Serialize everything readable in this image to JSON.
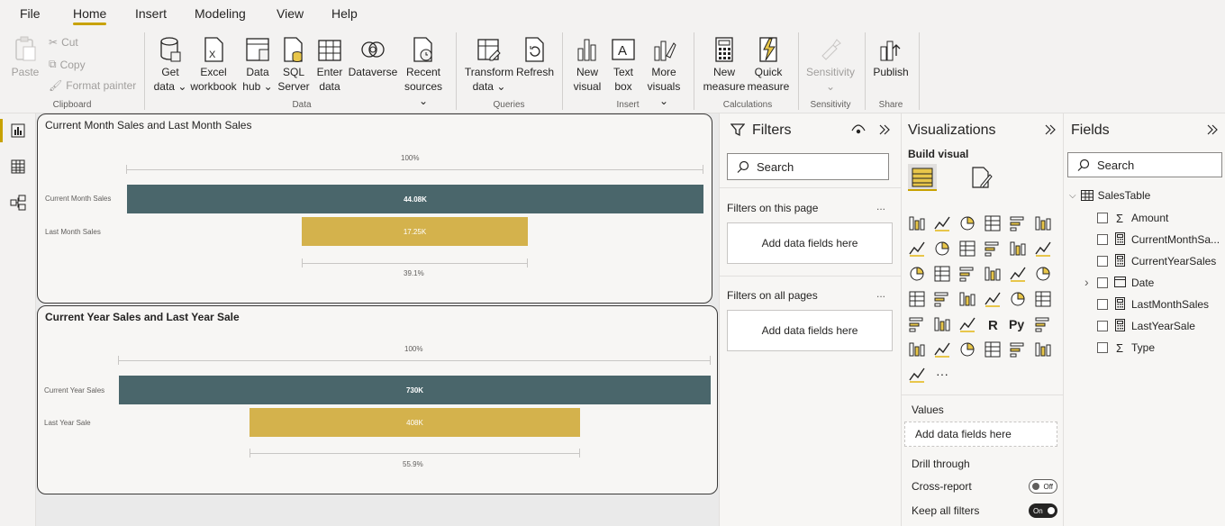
{
  "menu": {
    "items": [
      "File",
      "Home",
      "Insert",
      "Modeling",
      "View",
      "Help"
    ],
    "active": "Home"
  },
  "ribbon": {
    "clipboard": {
      "paste": "Paste",
      "cut": "Cut",
      "copy": "Copy",
      "format_painter": "Format painter",
      "group": "Clipboard"
    },
    "data": {
      "get_data": [
        "Get",
        "data ⌄"
      ],
      "excel": [
        "Excel",
        "workbook"
      ],
      "data_hub": [
        "Data",
        "hub ⌄"
      ],
      "sql": [
        "SQL",
        "Server"
      ],
      "enter": [
        "Enter",
        "data"
      ],
      "dataverse": "Dataverse",
      "recent": [
        "Recent",
        "sources ⌄"
      ],
      "group": "Data"
    },
    "queries": {
      "transform": [
        "Transform",
        "data ⌄"
      ],
      "refresh": "Refresh",
      "group": "Queries"
    },
    "insert": {
      "new_visual": [
        "New",
        "visual"
      ],
      "text_box": [
        "Text",
        "box"
      ],
      "more_visuals": [
        "More",
        "visuals ⌄"
      ],
      "group": "Insert"
    },
    "calculations": {
      "new_measure": [
        "New",
        "measure"
      ],
      "quick_measure": [
        "Quick",
        "measure"
      ],
      "group": "Calculations"
    },
    "sensitivity": {
      "label": "Sensitivity",
      "chev": "⌄",
      "group": "Sensitivity"
    },
    "share": {
      "publish": "Publish",
      "group": "Share"
    }
  },
  "visuals": [
    {
      "title": "Current Month Sales and Last Month Sales",
      "top_pct": "100%",
      "bottom_pct": "39.1%",
      "rows": [
        {
          "label": "Current Month Sales",
          "value": "44.08K",
          "color": "#4a666b"
        },
        {
          "label": "Last Month Sales",
          "value": "17.25K",
          "color": "#d4b24c"
        }
      ]
    },
    {
      "title": "Current Year Sales and Last Year Sale",
      "top_pct": "100%",
      "bottom_pct": "55.9%",
      "rows": [
        {
          "label": "Current Year Sales",
          "value": "730K",
          "color": "#4a666b"
        },
        {
          "label": "Last Year Sale",
          "value": "408K",
          "color": "#d4b24c"
        }
      ]
    }
  ],
  "filters": {
    "title": "Filters",
    "search_placeholder": "Search",
    "on_this_page": "Filters on this page",
    "on_all_pages": "Filters on all pages",
    "add_fields": "Add data fields here",
    "more": "..."
  },
  "viz": {
    "title": "Visualizations",
    "build_visual": "Build visual",
    "values": "Values",
    "add_fields": "Add data fields here",
    "drill_through": "Drill through",
    "cross_report": "Cross-report",
    "cross_report_state": "Off",
    "keep_filters": "Keep all filters",
    "keep_filters_state": "On",
    "more": "···"
  },
  "fields": {
    "title": "Fields",
    "search_placeholder": "Search",
    "table": "SalesTable",
    "items": [
      {
        "name": "Amount",
        "icon": "sigma"
      },
      {
        "name": "CurrentMonthSa...",
        "icon": "calc"
      },
      {
        "name": "CurrentYearSales",
        "icon": "calc"
      },
      {
        "name": "Date",
        "icon": "calendar"
      },
      {
        "name": "LastMonthSales",
        "icon": "calc"
      },
      {
        "name": "LastYearSale",
        "icon": "calc"
      },
      {
        "name": "Type",
        "icon": "sigma"
      }
    ]
  },
  "colors": {
    "accent": "#c8a200",
    "teal": "#4a666b",
    "gold": "#d4b24c"
  }
}
